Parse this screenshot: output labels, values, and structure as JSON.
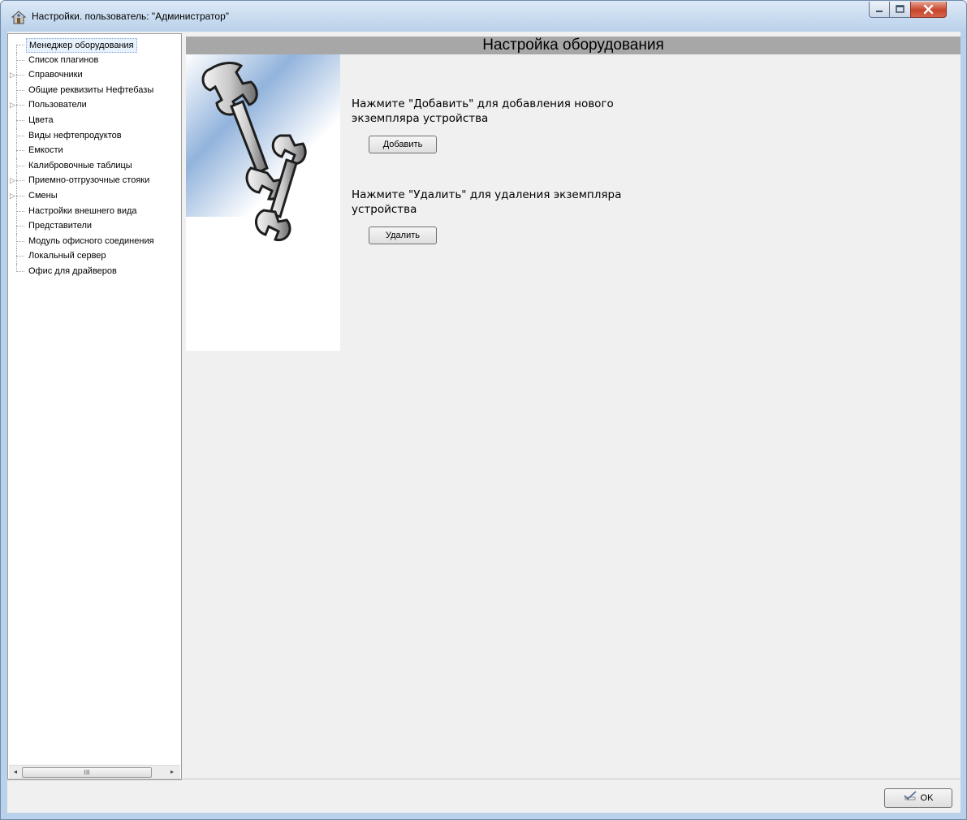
{
  "window": {
    "title": "Настройки. пользователь: \"Администратор\"",
    "controls": {
      "minimize": "minimize-icon",
      "maximize": "maximize-icon",
      "close": "close-icon"
    }
  },
  "tree": {
    "items": [
      {
        "label": "Менеджер оборудования",
        "expandable": false,
        "selected": true
      },
      {
        "label": "Список плагинов",
        "expandable": false
      },
      {
        "label": "Справочники",
        "expandable": true
      },
      {
        "label": "Общие реквизиты Нефтебазы",
        "expandable": false
      },
      {
        "label": "Пользователи",
        "expandable": true
      },
      {
        "label": "Цвета",
        "expandable": false
      },
      {
        "label": "Виды нефтепродуктов",
        "expandable": false
      },
      {
        "label": "Емкости",
        "expandable": false
      },
      {
        "label": "Калибровочные таблицы",
        "expandable": false
      },
      {
        "label": "Приемно-отгрузочные стояки",
        "expandable": true
      },
      {
        "label": "Смены",
        "expandable": true
      },
      {
        "label": "Настройки внешнего вида",
        "expandable": false
      },
      {
        "label": "Представители",
        "expandable": false
      },
      {
        "label": "Модуль офисного соединения",
        "expandable": false
      },
      {
        "label": "Локальный сервер",
        "expandable": false
      },
      {
        "label": "Офис для драйверов",
        "expandable": false
      }
    ],
    "scrollbar": {
      "left_arrow": "◂",
      "thumb_grip": "III",
      "right_arrow": "▸"
    }
  },
  "main": {
    "header": "Настройка оборудования",
    "illustration": "wrenches-icon",
    "add_text": "Нажмите \"Добавить\" для добавления нового экземпляра устройства",
    "add_button": "Добавить",
    "delete_text": "Нажмите \"Удалить\" для удаления экземпляра устройства",
    "delete_button": "Удалить"
  },
  "footer": {
    "ok_button": "OK",
    "ok_icon": "checkmark-pen-icon"
  },
  "colors": {
    "header_bg": "#a7a7a7",
    "client_bg": "#f0f0f0",
    "frame": "#b9d1ea",
    "close_button": "#c8442a"
  }
}
